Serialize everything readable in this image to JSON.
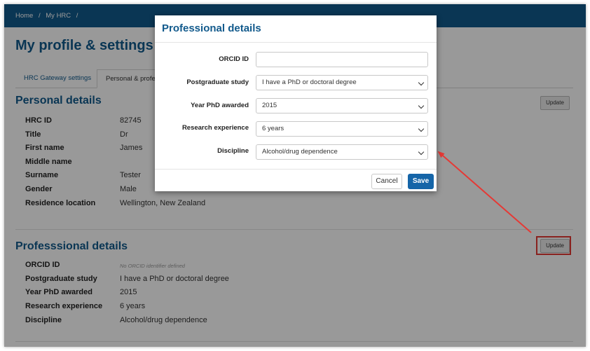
{
  "breadcrumb": [
    "Home",
    "/",
    "My HRC",
    "/"
  ],
  "page_title": "My profile & settings",
  "tabs": [
    {
      "label": "HRC Gateway settings"
    },
    {
      "label": "Personal & profess"
    }
  ],
  "personal": {
    "title": "Personal details",
    "update_label": "Update",
    "rows": [
      {
        "label": "HRC ID",
        "value": "82745"
      },
      {
        "label": "Title",
        "value": "Dr"
      },
      {
        "label": "First name",
        "value": "James"
      },
      {
        "label": "Middle name",
        "value": ""
      },
      {
        "label": "Surname",
        "value": "Tester"
      },
      {
        "label": "Gender",
        "value": "Male"
      },
      {
        "label": "Residence location",
        "value": "Wellington, New Zealand"
      }
    ]
  },
  "professional": {
    "title": "Professsional details",
    "update_label": "Update",
    "rows": [
      {
        "label": "ORCID ID",
        "value": "No ORCID identifier defined"
      },
      {
        "label": "Postgraduate study",
        "value": "I have a PhD or doctoral degree"
      },
      {
        "label": "Year PhD awarded",
        "value": "2015"
      },
      {
        "label": "Research experience",
        "value": "6 years"
      },
      {
        "label": "Discipline",
        "value": "Alcohol/drug dependence"
      }
    ]
  },
  "modal": {
    "title": "Professional details",
    "fields": [
      {
        "label": "ORCID ID",
        "value": ""
      },
      {
        "label": "Postgraduate study",
        "value": "I have a PhD or doctoral degree"
      },
      {
        "label": "Year PhD awarded",
        "value": "2015"
      },
      {
        "label": "Research experience",
        "value": "6 years"
      },
      {
        "label": "Discipline",
        "value": "Alcohol/drug dependence"
      }
    ],
    "cancel_label": "Cancel",
    "save_label": "Save"
  },
  "annotation_color": "#e53935",
  "accent_color": "#125a8c"
}
